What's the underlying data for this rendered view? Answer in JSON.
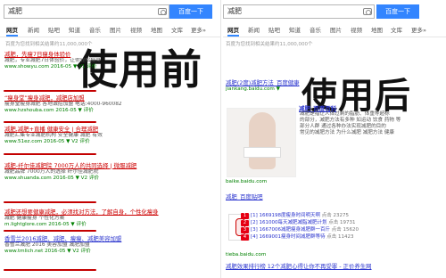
{
  "left": {
    "search_value": "减肥",
    "search_button": "百度一下",
    "tabs": [
      "网页",
      "新闻",
      "贴吧",
      "知道",
      "音乐",
      "图片",
      "视频",
      "地图",
      "文库",
      "更多»"
    ],
    "result_count": "百度为您找到相关结果约11,000,000个",
    "big_label": "使用前",
    "results": [
      {
        "title": "减肥，先瘦7日瘦身体验价",
        "url": "www.showyu.com 2016-05 ▼ V1 评价",
        "desc": "减肥，专业减肥7日体验价，让你轻松瘦身"
      },
      {
        "title": "“瘦身堂”瘦身减肥，减肥店加盟",
        "url": "www.hzshouba.com 2016-05 ▼ 评价",
        "desc": "瘦身堂瘦身减肥 各地诚招加盟 电话:4000-960082"
      },
      {
        "title": "减肥,减肥+直播 健康安全 | 合理减肥",
        "url": "www.51ez.com 2016-05 ▼ V2 评价",
        "desc": "减肥汇集专业减肥机构 安全健康 减肥 有效"
      },
      {
        "title": "减肥-纤尔佳减肥院 7000万人的共同选择 | 微服减肥",
        "url": "www.shuanda.com 2016-05 ▼ V2 评价",
        "desc": "减肥品牌 7000万人的选择 纤尔佳减肥院"
      },
      {
        "title": "减肥还想要健康减肥，必须找对方法，了解自身，个性化瘦身",
        "url": "m.lightglore.com 2016-05 ▼ 评价",
        "desc": "减肥 健康瘦身 个性化方案"
      },
      {
        "title": "香雪兰2016减肥、减肥、瘦瘦、减肥美容加盟",
        "url": "www.tmlich.net 2016-05 ▼ V2 评价",
        "desc": "香雪兰减肥 2016 美容加盟 减肥加盟"
      }
    ]
  },
  "right": {
    "search_value": "减肥",
    "search_button": "百度一下",
    "tabs": [
      "网页",
      "新闻",
      "贴吧",
      "知道",
      "音乐",
      "图片",
      "视频",
      "地图",
      "文库",
      "更多»"
    ],
    "result_count": "百度为您找到相关结果约11,000,000个",
    "big_label": "使用后",
    "results": [
      {
        "title": "减肥(2度)减肥方法_百度健康",
        "url": "jiankang.baidu.com ▼",
        "desc": "减肥 减肥方法 百度健康"
      },
      {
        "title": "减肥_百度百科",
        "url": "baike.baidu.com",
        "desc": "减肥是指让人体过剩的脂肪，体重等超标的部分"
      },
      {
        "title": "减肥_百度贴吧",
        "url": "tieba.baidu.com",
        "desc": "贴吧 减肥吧 相关帖子"
      },
      {
        "title": "减肥效果排行榜 12个减肥心得让你不再受罪 - 正价养生网",
        "url": "",
        "desc": ""
      }
    ],
    "wiki_desc": [
      "减肥是指让人体过剩的脂肪、体重等超标",
      "的部分，减肥方法有多种 如运动 饮食 药物 等",
      "部分人群 通过各种办法实现减肥的目的",
      "常见的减肥方法 为什么减肥 减肥方法 健康"
    ],
    "tieba_items": [
      "[1] 1669198度瘦身时间明天啊",
      "[2] 161000每天减肥减脂减肥计划",
      "[3] 1667006减肥瘦身减肥群一百斤",
      "[4] 1669001瘦身时间减肥群等待"
    ],
    "tieba_meta": [
      "点击 23275",
      "点击 19731",
      "点击 15620",
      "点击 11423"
    ]
  }
}
